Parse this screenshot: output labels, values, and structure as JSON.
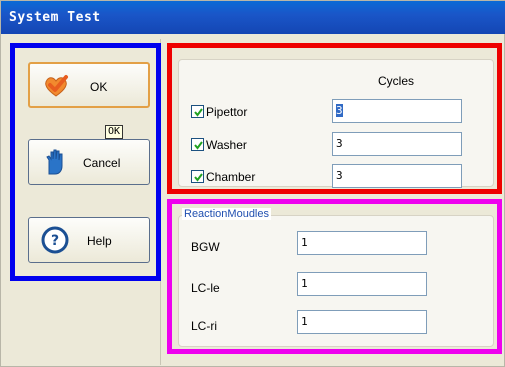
{
  "window": {
    "title": "System Test"
  },
  "buttons": {
    "ok": {
      "label": "OK",
      "icon": "check-heart-icon"
    },
    "cancel": {
      "label": "Cancel",
      "icon": "hand-icon"
    },
    "help": {
      "label": "Help",
      "icon": "question-icon"
    }
  },
  "tooltip": {
    "text": "OK"
  },
  "cycles": {
    "header": "Cycles",
    "rows": [
      {
        "label": "Pipettor",
        "checked": true,
        "value": "3"
      },
      {
        "label": "Washer",
        "checked": true,
        "value": "3"
      },
      {
        "label": "Chamber",
        "checked": true,
        "value": "3"
      }
    ]
  },
  "reaction": {
    "title": "ReactionMoudles",
    "rows": [
      {
        "label": "BGW",
        "value": "1"
      },
      {
        "label": "LC-le",
        "value": "1"
      },
      {
        "label": "LC-ri",
        "value": "1"
      }
    ]
  },
  "colors": {
    "titlebar": "#1a56c8",
    "highlight_blue": "#0000ee",
    "highlight_red": "#ee0000",
    "highlight_magenta": "#ee00ee",
    "group_title": "#1f4fb0"
  }
}
